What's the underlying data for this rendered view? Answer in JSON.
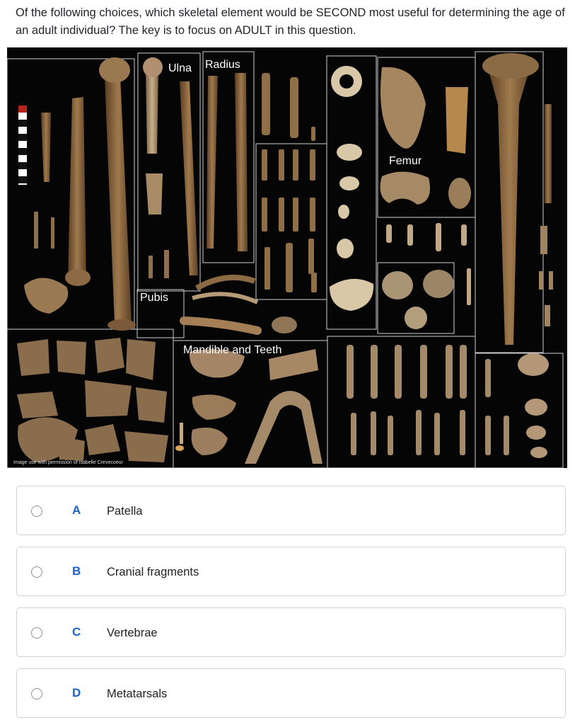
{
  "question": "Of the following choices, which skeletal element would be SECOND most useful for determining the age of an adult individual? The key is to focus on ADULT in this question.",
  "figure": {
    "labels": {
      "ulna": "Ulna",
      "radius": "Radius",
      "femur": "Femur",
      "pubis": "Pubis",
      "mandible": "Mandible and Teeth"
    },
    "credit": "Image use with permission of Isabelle Crevecoeur"
  },
  "choices": [
    {
      "letter": "A",
      "text": "Patella"
    },
    {
      "letter": "B",
      "text": "Cranial fragments"
    },
    {
      "letter": "C",
      "text": "Vertebrae"
    },
    {
      "letter": "D",
      "text": "Metatarsals"
    }
  ]
}
